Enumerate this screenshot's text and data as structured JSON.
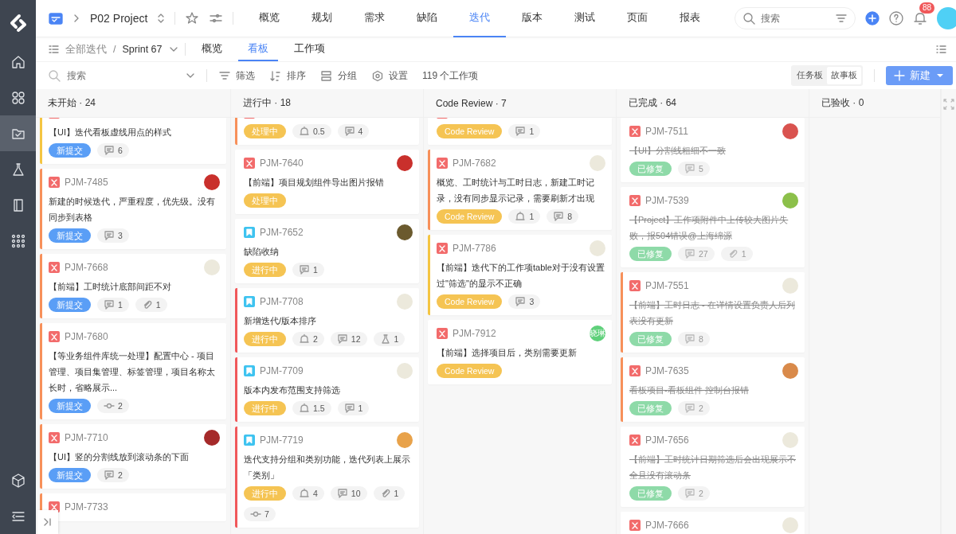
{
  "topbar": {
    "project": "P02 Project",
    "nav": [
      {
        "label": "概览",
        "selected": false
      },
      {
        "label": "规划",
        "selected": false
      },
      {
        "label": "需求",
        "selected": false
      },
      {
        "label": "缺陷",
        "selected": false
      },
      {
        "label": "迭代",
        "selected": true
      },
      {
        "label": "版本",
        "selected": false
      },
      {
        "label": "测试",
        "selected": false
      },
      {
        "label": "页面",
        "selected": false
      },
      {
        "label": "报表",
        "selected": false
      }
    ],
    "search": {
      "placeholder": "搜索"
    },
    "notifications": "88"
  },
  "subbar": {
    "breadcrumb": [
      "全部迭代",
      "/",
      "Sprint 67"
    ],
    "tabs": [
      {
        "label": "概览",
        "selected": false
      },
      {
        "label": "看板",
        "selected": true
      },
      {
        "label": "工作项",
        "selected": false
      }
    ]
  },
  "toolbar": {
    "search": {
      "placeholder": "搜索"
    },
    "actions": [
      {
        "kind": "filter",
        "label": "筛选"
      },
      {
        "kind": "sort",
        "label": "排序"
      },
      {
        "kind": "group",
        "label": "分组"
      },
      {
        "kind": "settings",
        "label": "设置"
      }
    ],
    "count": "119 个工作项",
    "boards": [
      {
        "label": "任务板",
        "selected": false
      },
      {
        "label": "故事板",
        "selected": true
      }
    ],
    "create": "新建"
  },
  "columns": [
    {
      "title": "未开始 · 24",
      "cards": [
        {
          "kind": "bug",
          "color": "#f4c542",
          "title": "【UI】迭代看板虚线用点的样式",
          "status": {
            "label": "新提交",
            "color": "#5a9ef6"
          },
          "metrics": [
            {
              "kind": "comment",
              "value": "6"
            }
          ],
          "completed": false
        },
        {
          "id": "PJM-7485",
          "kind": "bug",
          "color": "#f7905a",
          "title": "新建的时候迭代，严重程度，优先级。没有同步到表格",
          "status": {
            "label": "新提交",
            "color": "#5a9ef6"
          },
          "metrics": [
            {
              "kind": "comment",
              "value": "3"
            }
          ],
          "avatar": {
            "color": "#c9302c"
          },
          "completed": false
        },
        {
          "id": "PJM-7668",
          "kind": "bug",
          "color": "#f7905a",
          "title": "【前端】工时统计底部间距不对",
          "status": {
            "label": "新提交",
            "color": "#5a9ef6"
          },
          "metrics": [
            {
              "kind": "comment",
              "value": "1"
            },
            {
              "kind": "attachment",
              "value": "1"
            }
          ],
          "avatar": {
            "color": "#ece9dc"
          },
          "completed": false
        },
        {
          "id": "PJM-7680",
          "kind": "bug",
          "color": "#f7905a",
          "title": "【等业务组件库统一处理】配置中心 - 项目管理、项目集管理、标签管理，项目名称太长时，省略展示...",
          "status": {
            "label": "新提交",
            "color": "#5a9ef6"
          },
          "metrics": [
            {
              "kind": "cycle",
              "value": "2"
            }
          ],
          "completed": false
        },
        {
          "id": "PJM-7710",
          "kind": "bug",
          "color": "#f7905a",
          "title": "【UI】竖的分割线放到滚动条的下面",
          "status": {
            "label": "新提交",
            "color": "#5a9ef6"
          },
          "metrics": [
            {
              "kind": "comment",
              "value": "2"
            }
          ],
          "avatar": {
            "color": "#a52a2a"
          },
          "completed": false
        },
        {
          "id": "PJM-7733",
          "kind": "bug",
          "color": "#f7905a"
        }
      ]
    },
    {
      "title": "进行中 · 18",
      "cards": [
        {
          "kind": "bug",
          "color": "#f7905a",
          "status": {
            "label": "处理中",
            "color": "#f5c453"
          },
          "metrics": [
            {
              "kind": "hours",
              "value": "0.5"
            },
            {
              "kind": "comment",
              "value": "4"
            }
          ],
          "completed": false
        },
        {
          "id": "PJM-7640",
          "kind": "bug",
          "title": "【前端】项目规划组件导出图片报错",
          "status": {
            "label": "处理中",
            "color": "#f5c453"
          },
          "avatar": {
            "color": "#c9302c"
          },
          "completed": false
        },
        {
          "id": "PJM-7652",
          "kind": "story",
          "title": "缺陷收纳",
          "status": {
            "label": "进行中",
            "color": "#f5c453"
          },
          "metrics": [
            {
              "kind": "comment",
              "value": "1"
            }
          ],
          "avatar": {
            "color": "#6b5a2e"
          },
          "completed": false
        },
        {
          "id": "PJM-7708",
          "kind": "story",
          "color": "#f0585a",
          "title": "新增迭代/版本排序",
          "status": {
            "label": "进行中",
            "color": "#f5c453"
          },
          "metrics": [
            {
              "kind": "hours",
              "value": "2"
            },
            {
              "kind": "comment",
              "value": "12"
            },
            {
              "kind": "test",
              "value": "1"
            }
          ],
          "avatar": {
            "color": "#ece9dc"
          },
          "completed": false
        },
        {
          "id": "PJM-7709",
          "kind": "story",
          "color": "#f0585a",
          "title": "版本内发布范围支持筛选",
          "status": {
            "label": "进行中",
            "color": "#f5c453"
          },
          "metrics": [
            {
              "kind": "hours",
              "value": "1.5"
            },
            {
              "kind": "comment",
              "value": "1"
            }
          ],
          "avatar": {
            "color": "#ece9dc"
          },
          "completed": false
        },
        {
          "id": "PJM-7719",
          "kind": "story",
          "color": "#f0585a",
          "title": "迭代支持分组和类别功能，迭代列表上展示「类别」",
          "status": {
            "label": "进行中",
            "color": "#f5c453"
          },
          "metrics": [
            {
              "kind": "hours",
              "value": "4"
            },
            {
              "kind": "comment",
              "value": "10"
            },
            {
              "kind": "attachment",
              "value": "1"
            },
            {
              "kind": "cycle",
              "value": "7"
            }
          ],
          "avatar": {
            "color": "#e8a24a"
          },
          "completed": false
        }
      ]
    },
    {
      "title": "Code Review · 7",
      "cards": [
        {
          "kind": "bug",
          "status": {
            "label": "Code Review",
            "color": "#f5c453"
          },
          "metrics": [
            {
              "kind": "comment",
              "value": "1"
            }
          ],
          "completed": false
        },
        {
          "id": "PJM-7682",
          "kind": "bug",
          "color": "#f7905a",
          "title": "概览、工时统计与工时日志，新建工时记录，没有同步显示记录，需要刷新才出现",
          "status": {
            "label": "Code Review",
            "color": "#f5c453"
          },
          "metrics": [
            {
              "kind": "hours",
              "value": "1"
            },
            {
              "kind": "comment",
              "value": "8"
            }
          ],
          "avatar": {
            "color": "#ece9dc"
          },
          "completed": false
        },
        {
          "id": "PJM-7786",
          "kind": "bug",
          "color": "#f4c542",
          "title": "【前端】迭代下的工作项table对于没有设置过\"筛选\"的显示不正确",
          "status": {
            "label": "Code Review",
            "color": "#f5c453"
          },
          "metrics": [
            {
              "kind": "comment",
              "value": "3"
            }
          ],
          "avatar": {
            "color": "#ece9dc"
          },
          "completed": false
        },
        {
          "id": "PJM-7912",
          "kind": "bug",
          "title": "【前端】选择项目后，类别需要更新",
          "status": {
            "label": "Code Review",
            "color": "#f5c453"
          },
          "avatar": {
            "color": "#5fd07a",
            "label": "晓琳"
          },
          "completed": false
        }
      ]
    },
    {
      "title": "已完成 · 64",
      "cards": [
        {
          "id": "PJM-7511",
          "kind": "bug",
          "title": "【UI】分割线粗细不一致",
          "status": {
            "label": "已修复",
            "color": "#8edaa8"
          },
          "metrics": [
            {
              "kind": "comment",
              "value": "5"
            }
          ],
          "avatar": {
            "color": "#d9534f"
          },
          "completed": true
        },
        {
          "id": "PJM-7539",
          "kind": "bug",
          "title": "【Project】工作项附件中上传较大图片失败，报504错误@上海绵源",
          "status": {
            "label": "已修复",
            "color": "#8edaa8"
          },
          "metrics": [
            {
              "kind": "comment",
              "value": "27"
            },
            {
              "kind": "attachment",
              "value": "1"
            }
          ],
          "avatar": {
            "color": "#8cc04a"
          },
          "completed": true
        },
        {
          "id": "PJM-7551",
          "kind": "bug",
          "color": "#f7905a",
          "title": "【前端】工时日志 - 在详情设置负责人后列表没有更新",
          "status": {
            "label": "已修复",
            "color": "#8edaa8"
          },
          "metrics": [
            {
              "kind": "comment",
              "value": "8"
            }
          ],
          "avatar": {
            "color": "#ece9dc"
          },
          "completed": true
        },
        {
          "id": "PJM-7635",
          "kind": "bug",
          "color": "#f7905a",
          "title": "看板项目-看板组件 控制台报错",
          "status": {
            "label": "已修复",
            "color": "#8edaa8"
          },
          "metrics": [
            {
              "kind": "comment",
              "value": "2"
            }
          ],
          "avatar": {
            "color": "#d98a4a"
          },
          "completed": true
        },
        {
          "id": "PJM-7656",
          "kind": "bug",
          "title": "【前端】工时统计日期筛选后会出现展示不全且没有滚动条",
          "status": {
            "label": "已修复",
            "color": "#8edaa8"
          },
          "metrics": [
            {
              "kind": "comment",
              "value": "2"
            }
          ],
          "avatar": {
            "color": "#ece9dc"
          },
          "completed": true
        },
        {
          "id": "PJM-7666",
          "kind": "bug",
          "avatar": {
            "color": "#ece9dc"
          }
        }
      ]
    },
    {
      "title": "已验收 · 0"
    }
  ]
}
